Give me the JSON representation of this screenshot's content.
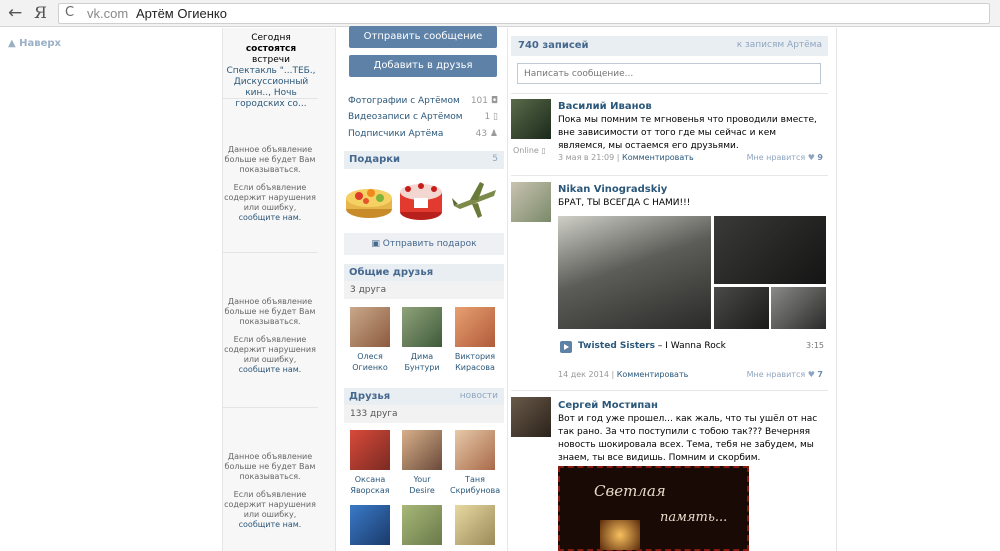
{
  "browser": {
    "domain": "vk.com",
    "title": "Артём Огиенко",
    "back_glyph": "←",
    "yandex_glyph": "Я",
    "reload_glyph": "C"
  },
  "nav": {
    "back_to_top": "▲ Наверх"
  },
  "events": {
    "prefix": "Сегодня ",
    "bold": "состоятся",
    "middle": " встречи ",
    "items": "Спектакль \"...ТЕБ., Дискуссионный кин.., Ночь городских со..."
  },
  "ad": {
    "line1": "Данное объявление больше не будет Вам показываться.",
    "line2": "Если объявление содержит нарушения или ошибку,",
    "link": "сообщите нам."
  },
  "profile": {
    "send_message": "Отправить сообщение",
    "add_friend": "Добавить в друзья",
    "stats": [
      {
        "label": "Фотографии с Артёмом",
        "count": "101 ◘"
      },
      {
        "label": "Видеозаписи с Артёмом",
        "count": "1 ▯"
      },
      {
        "label": "Подписчики Артёма",
        "count": "43 ♟"
      }
    ]
  },
  "gifts": {
    "title": "Подарки",
    "count": "5",
    "send": "Отправить подарок"
  },
  "mutual": {
    "title": "Общие друзья",
    "count": "3 друга",
    "people": [
      {
        "first": "Олеся",
        "last": "Огиенко"
      },
      {
        "first": "Дима",
        "last": "Бунтури"
      },
      {
        "first": "Виктория",
        "last": "Кирасова"
      }
    ]
  },
  "friends": {
    "title": "Друзья",
    "news": "новости",
    "count": "133 друга",
    "people": [
      {
        "first": "Оксана",
        "last": "Яворская"
      },
      {
        "first": "Your",
        "last": "Desire"
      },
      {
        "first": "Таня",
        "last": "Скрибунова"
      }
    ]
  },
  "wall": {
    "count": "740 записей",
    "to_wall": "к записям Артёма",
    "placeholder": "Написать сообщение...",
    "posts": [
      {
        "author": "Василий Иванов",
        "text": "Пока мы помним те мгновенья что проводили вместе, вне зависимости от того где мы сейчас и кем являемся, мы остаемся его друзьями.",
        "online": "Online ▯",
        "date": "3 мая в 21:09",
        "comment": "Комментировать",
        "like": "Мне нравится",
        "likes": "9"
      },
      {
        "author": "Nikan Vinogradskiy",
        "text": "БРАТ, ТЫ ВСЕГДА С НАМИ!!!",
        "audio_artist": "Twisted Sisters",
        "audio_title": " – I Wanna Rock",
        "audio_duration": "3:15",
        "date": "14 дек 2014",
        "comment": "Комментировать",
        "like": "Мне нравится",
        "likes": "7"
      },
      {
        "author": "Сергей Мостипан",
        "text": "Вот и год уже прошел... как жаль, что ты ушёл от нас так рано. За что поступили с тобою так??? Вечерняя новость шокировала всех. Тема, тебя не забудем, мы знаем, ты все видишь. Помним и скорбим.",
        "image_text1": "Светлая",
        "image_text2": "память..."
      }
    ]
  }
}
